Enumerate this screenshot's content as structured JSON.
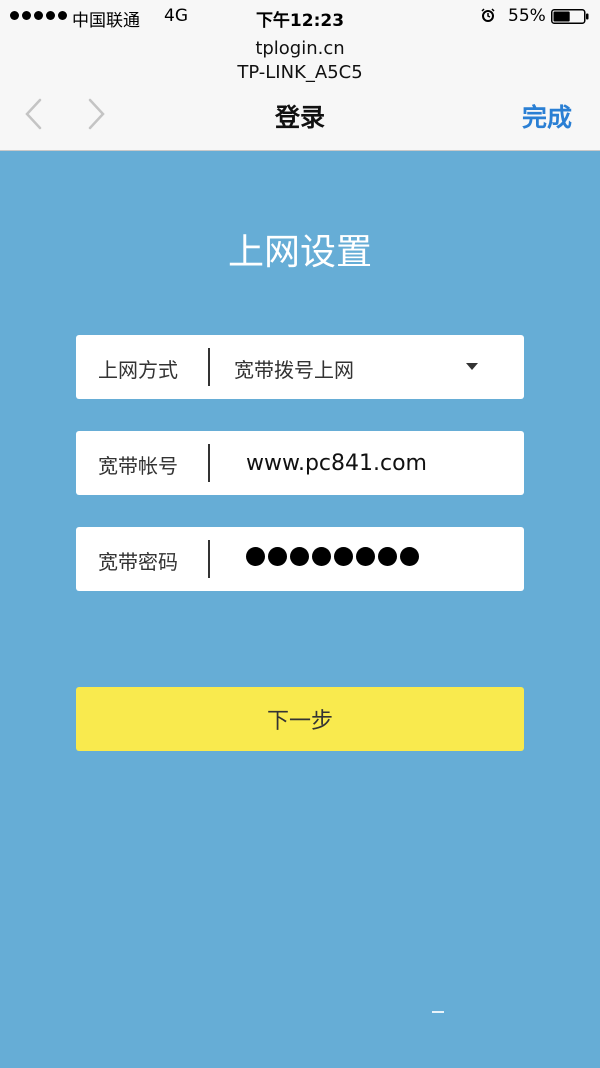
{
  "status_bar": {
    "carrier": "中国联通",
    "network": "4G",
    "time": "下午12:23",
    "battery": "55%",
    "battery_level": 0.55
  },
  "browser": {
    "host": "tplogin.cn",
    "page_title": "TP-LINK_A5C5",
    "heading": "登录",
    "done_label": "完成"
  },
  "form": {
    "title": "上网设置",
    "fields": [
      {
        "label": "上网方式",
        "value": "宽带拨号上网"
      },
      {
        "label": "宽带帐号",
        "value": "www.pc841.com"
      },
      {
        "label": "宽带密码",
        "value": "●●●●●●●●"
      }
    ],
    "next_label": "下一步"
  },
  "colors": {
    "background": "#66add6",
    "accent": "#2a7fd4",
    "button": "#f9ea4e"
  },
  "icons": {
    "back": "chevron-left-icon",
    "forward": "chevron-right-icon",
    "dropdown": "caret-down-icon",
    "alarm": "alarm-clock-icon",
    "battery": "battery-icon"
  }
}
